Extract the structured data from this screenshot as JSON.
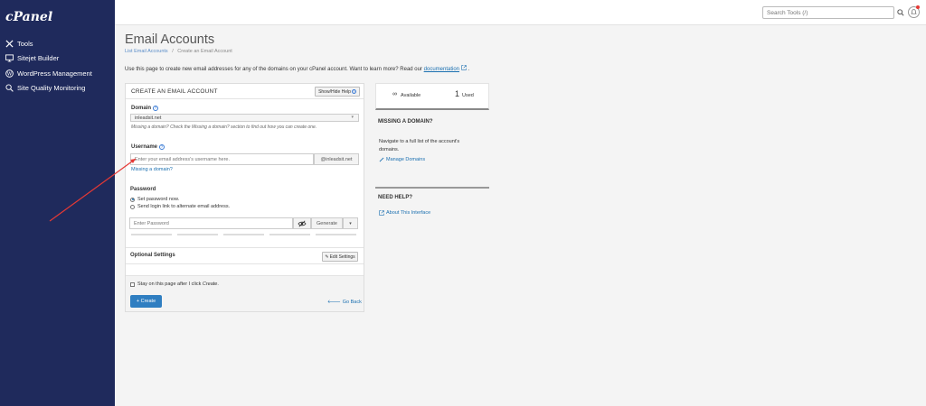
{
  "sidebar": {
    "logo": "cPanel",
    "items": [
      {
        "label": "Tools",
        "icon": "tools-icon"
      },
      {
        "label": "Sitejet Builder",
        "icon": "monitor-icon"
      },
      {
        "label": "WordPress Management",
        "icon": "wordpress-icon"
      },
      {
        "label": "Site Quality Monitoring",
        "icon": "magnifier-icon"
      }
    ]
  },
  "topbar": {
    "search_placeholder": "Search Tools (/)"
  },
  "page": {
    "title": "Email Accounts",
    "breadcrumb_link": "List Email Accounts",
    "breadcrumb_sep": "/",
    "breadcrumb_current": "Create an Email Account",
    "intro_text": "Use this page to create new email addresses for any of the domains on your cPanel account. Want to learn more? Read our",
    "intro_link": "documentation",
    "intro_end": "."
  },
  "form": {
    "title": "CREATE AN EMAIL ACCOUNT",
    "show_hide_help": "Show/Hide Help",
    "domain_label": "Domain",
    "domain_value": "inleadsit.net",
    "domain_hint": "Missing a domain? Check the Missing a domain? section to find out how you can create one.",
    "username_label": "Username",
    "username_placeholder": "Enter your email address's username here.",
    "username_suffix": "@inleadsit.net",
    "missing_domain_link": "Missing a domain?",
    "password_label": "Password",
    "radio_set": "Set password now.",
    "radio_send": "Send login link to alternate email address.",
    "password_placeholder": "Enter Password",
    "generate": "Generate",
    "optional_settings": "Optional Settings",
    "edit_settings": "Edit Settings",
    "stay_text": "Stay on this page after I click ",
    "stay_text_em": "Create",
    "stay_text_end": ".",
    "create": "+ Create",
    "go_back": "Go Back"
  },
  "side": {
    "available_label": "Available",
    "used_count": "1",
    "used_label": "Used",
    "missing_title": "MISSING A DOMAIN?",
    "missing_text": "Navigate to a full list of the account's domains.",
    "manage_link": "Manage Domains",
    "help_title": "NEED HELP?",
    "about_link": "About This Interface"
  },
  "colors": {
    "sidebar_bg": "#1f2a5c",
    "accent": "#2f7ec1",
    "annotation": "#e53935"
  }
}
